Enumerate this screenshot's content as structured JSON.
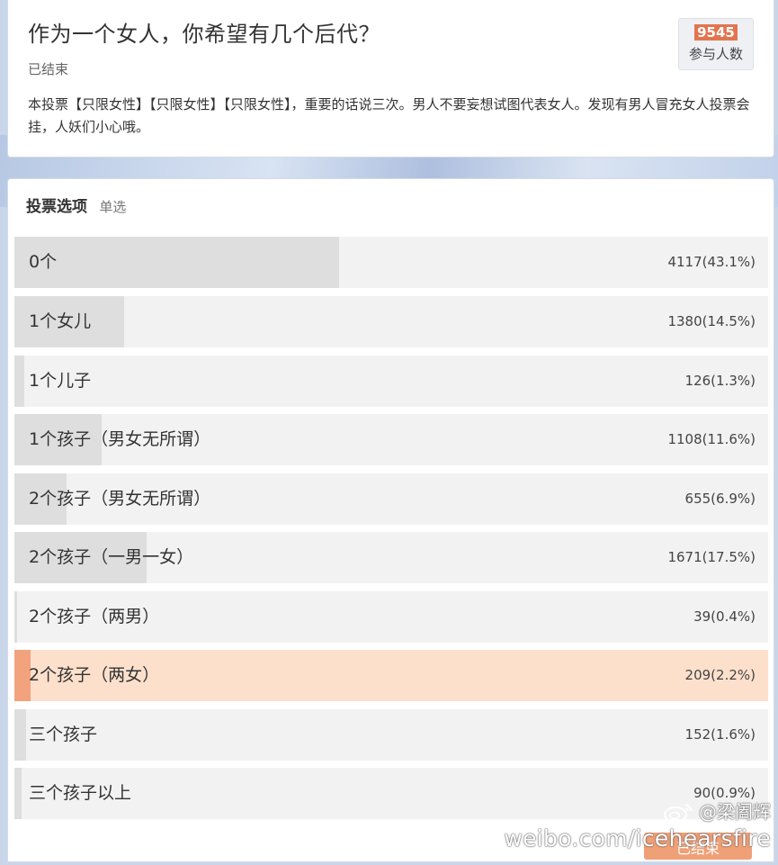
{
  "poll": {
    "title": "作为一个女人，你希望有几个后代？",
    "status": "已结束",
    "description": "本投票【只限女性】【只限女性】【只限女性】，重要的话说三次。男人不要妄想试图代表女人。发现有男人冒充女人投票会挂，人妖们小心哦。",
    "participants": "9545",
    "participants_label": "参与人数"
  },
  "options_header": {
    "title": "投票选项",
    "type": "单选"
  },
  "options": [
    {
      "label": "0个",
      "count": "4117(43.1%)",
      "percent": 43.1,
      "selected": false
    },
    {
      "label": "1个女儿",
      "count": "1380(14.5%)",
      "percent": 14.5,
      "selected": false
    },
    {
      "label": "1个儿子",
      "count": "126(1.3%)",
      "percent": 1.3,
      "selected": false
    },
    {
      "label": "1个孩子（男女无所谓）",
      "count": "1108(11.6%)",
      "percent": 11.6,
      "selected": false
    },
    {
      "label": "2个孩子（男女无所谓）",
      "count": "655(6.9%)",
      "percent": 6.9,
      "selected": false
    },
    {
      "label": "2个孩子（一男一女）",
      "count": "1671(17.5%)",
      "percent": 17.5,
      "selected": false
    },
    {
      "label": "2个孩子（两男）",
      "count": "39(0.4%)",
      "percent": 0.4,
      "selected": false
    },
    {
      "label": "2个孩子（两女）",
      "count": "209(2.2%)",
      "percent": 2.2,
      "selected": true
    },
    {
      "label": "三个孩子",
      "count": "152(1.6%)",
      "percent": 1.6,
      "selected": false
    },
    {
      "label": "三个孩子以上",
      "count": "90(0.9%)",
      "percent": 0.9,
      "selected": false
    }
  ],
  "footer": {
    "ended_button": "已结束"
  },
  "watermark": {
    "handle": "@梁阖辉",
    "url": "weibo.com/icehearsfire",
    "logo_icon": "weibo-logo-icon"
  },
  "colors": {
    "selected_fill": "#f2a27c",
    "selected_bg": "#fde0cc",
    "bar_fill": "#dedede",
    "bar_bg": "#f2f2f2",
    "count_badge": "#e2754f"
  }
}
